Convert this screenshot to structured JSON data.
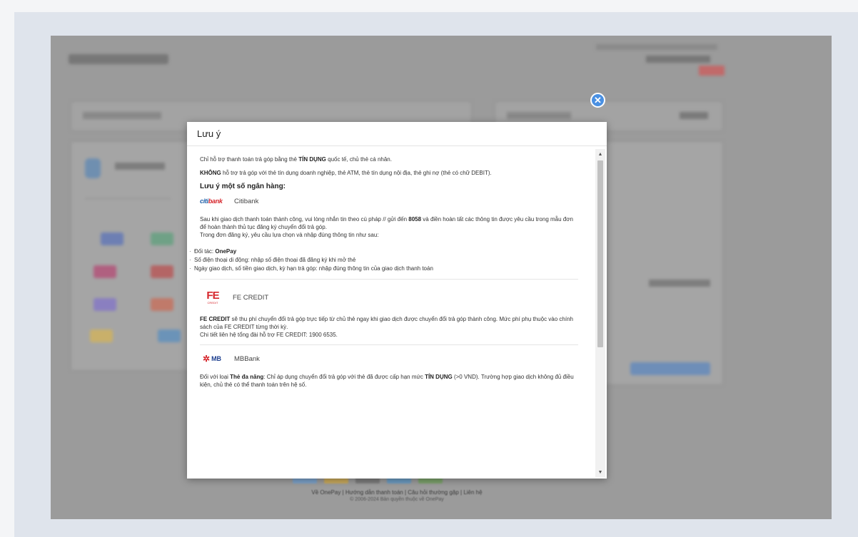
{
  "modal": {
    "title": "Lưu ý",
    "close_icon": "close-icon",
    "p1_a": "Chỉ hỗ trợ thanh toán trả góp bằng thẻ ",
    "p1_b": "TÍN DỤNG",
    "p1_c": " quốc tế, chủ thẻ cá nhân.",
    "p2_a": "KHÔNG",
    "p2_b": " hỗ trợ trả góp với thẻ tín dụng doanh nghiệp, thẻ ATM, thẻ tín dụng nội địa, thẻ ghi nợ (thẻ có chữ DEBIT).",
    "heading": "Lưu ý một số ngân hàng:",
    "citibank": {
      "logo_a": "citi",
      "logo_b": "bank",
      "name": "Citibank",
      "text_a": "Sau khi giao dịch thanh toán thành công, vui lòng nhắn tin theo cú pháp // gửi đến ",
      "text_b": "8058",
      "text_c": " và điền hoàn tất các thông tin được yêu cầu trong mẫu đơn để hoàn thành thủ tục đăng ký chuyển đổi trả góp.",
      "text_d": "Trong đơn đăng ký, yêu cầu lựa chọn và nhập đúng thông tin như sau:",
      "list": [
        {
          "a": "Đối tác: ",
          "b": "OnePay"
        },
        {
          "a": "Số điện thoại di động: nhập số điện thoại đã đăng ký khi mở thẻ",
          "b": ""
        },
        {
          "a": "Ngày giao dịch, số tiền giao dịch, kỳ hạn trả góp: nhập đúng thông tin của giao dịch thanh toán",
          "b": ""
        }
      ]
    },
    "fecredit": {
      "logo": "FE",
      "logo_sub": "CREDIT",
      "name": "FE CREDIT",
      "text_a": "FE CREDIT",
      "text_b": " sẽ thu phí chuyển đổi trả góp trực tiếp từ chủ thẻ ngay khi giao dịch được chuyển đổi trả góp thành công. Mức phí phụ thuộc vào chính sách của FE CREDIT từng thời kỳ.",
      "text_c": "Chi tiết liên hệ tổng đài hỗ trợ FE CREDIT: 1900 6535."
    },
    "mbbank": {
      "logo": "MB",
      "name": "MBBank",
      "text_a": "Đối với loại ",
      "text_b": "Thẻ đa năng",
      "text_c": ": Chỉ áp dụng chuyển đổi trả góp với thẻ đã được cấp hạn mức ",
      "text_d": "TÍN DỤNG",
      "text_e": " (>0 VND). Trường hợp giao dịch không đủ điều kiện, chủ thẻ có thể thanh toán trên hệ số."
    }
  },
  "footer": {
    "links": "Về OnePay | Hướng dẫn thanh toán | Câu hỏi thường gặp | Liên hệ",
    "copyright": "© 2006-2024 Bản quyền thuộc về OnePay"
  },
  "colors": {
    "accent": "#4a90e2",
    "overlay": "#9b9b9b",
    "brand_red": "#d6262c"
  }
}
